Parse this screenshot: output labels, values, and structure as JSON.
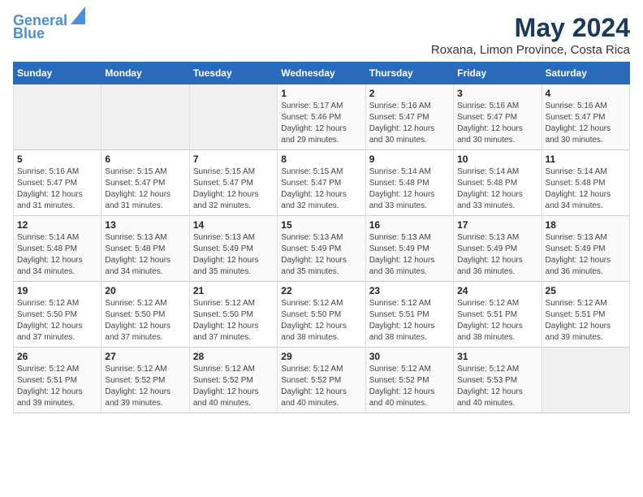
{
  "header": {
    "logo_line1": "General",
    "logo_line2": "Blue",
    "month_year": "May 2024",
    "location": "Roxana, Limon Province, Costa Rica"
  },
  "days_of_week": [
    "Sunday",
    "Monday",
    "Tuesday",
    "Wednesday",
    "Thursday",
    "Friday",
    "Saturday"
  ],
  "weeks": [
    [
      {
        "day": "",
        "info": ""
      },
      {
        "day": "",
        "info": ""
      },
      {
        "day": "",
        "info": ""
      },
      {
        "day": "1",
        "info": "Sunrise: 5:17 AM\nSunset: 5:46 PM\nDaylight: 12 hours\nand 29 minutes."
      },
      {
        "day": "2",
        "info": "Sunrise: 5:16 AM\nSunset: 5:47 PM\nDaylight: 12 hours\nand 30 minutes."
      },
      {
        "day": "3",
        "info": "Sunrise: 5:16 AM\nSunset: 5:47 PM\nDaylight: 12 hours\nand 30 minutes."
      },
      {
        "day": "4",
        "info": "Sunrise: 5:16 AM\nSunset: 5:47 PM\nDaylight: 12 hours\nand 30 minutes."
      }
    ],
    [
      {
        "day": "5",
        "info": "Sunrise: 5:16 AM\nSunset: 5:47 PM\nDaylight: 12 hours\nand 31 minutes."
      },
      {
        "day": "6",
        "info": "Sunrise: 5:15 AM\nSunset: 5:47 PM\nDaylight: 12 hours\nand 31 minutes."
      },
      {
        "day": "7",
        "info": "Sunrise: 5:15 AM\nSunset: 5:47 PM\nDaylight: 12 hours\nand 32 minutes."
      },
      {
        "day": "8",
        "info": "Sunrise: 5:15 AM\nSunset: 5:47 PM\nDaylight: 12 hours\nand 32 minutes."
      },
      {
        "day": "9",
        "info": "Sunrise: 5:14 AM\nSunset: 5:48 PM\nDaylight: 12 hours\nand 33 minutes."
      },
      {
        "day": "10",
        "info": "Sunrise: 5:14 AM\nSunset: 5:48 PM\nDaylight: 12 hours\nand 33 minutes."
      },
      {
        "day": "11",
        "info": "Sunrise: 5:14 AM\nSunset: 5:48 PM\nDaylight: 12 hours\nand 34 minutes."
      }
    ],
    [
      {
        "day": "12",
        "info": "Sunrise: 5:14 AM\nSunset: 5:48 PM\nDaylight: 12 hours\nand 34 minutes."
      },
      {
        "day": "13",
        "info": "Sunrise: 5:13 AM\nSunset: 5:48 PM\nDaylight: 12 hours\nand 34 minutes."
      },
      {
        "day": "14",
        "info": "Sunrise: 5:13 AM\nSunset: 5:49 PM\nDaylight: 12 hours\nand 35 minutes."
      },
      {
        "day": "15",
        "info": "Sunrise: 5:13 AM\nSunset: 5:49 PM\nDaylight: 12 hours\nand 35 minutes."
      },
      {
        "day": "16",
        "info": "Sunrise: 5:13 AM\nSunset: 5:49 PM\nDaylight: 12 hours\nand 36 minutes."
      },
      {
        "day": "17",
        "info": "Sunrise: 5:13 AM\nSunset: 5:49 PM\nDaylight: 12 hours\nand 36 minutes."
      },
      {
        "day": "18",
        "info": "Sunrise: 5:13 AM\nSunset: 5:49 PM\nDaylight: 12 hours\nand 36 minutes."
      }
    ],
    [
      {
        "day": "19",
        "info": "Sunrise: 5:12 AM\nSunset: 5:50 PM\nDaylight: 12 hours\nand 37 minutes."
      },
      {
        "day": "20",
        "info": "Sunrise: 5:12 AM\nSunset: 5:50 PM\nDaylight: 12 hours\nand 37 minutes."
      },
      {
        "day": "21",
        "info": "Sunrise: 5:12 AM\nSunset: 5:50 PM\nDaylight: 12 hours\nand 37 minutes."
      },
      {
        "day": "22",
        "info": "Sunrise: 5:12 AM\nSunset: 5:50 PM\nDaylight: 12 hours\nand 38 minutes."
      },
      {
        "day": "23",
        "info": "Sunrise: 5:12 AM\nSunset: 5:51 PM\nDaylight: 12 hours\nand 38 minutes."
      },
      {
        "day": "24",
        "info": "Sunrise: 5:12 AM\nSunset: 5:51 PM\nDaylight: 12 hours\nand 38 minutes."
      },
      {
        "day": "25",
        "info": "Sunrise: 5:12 AM\nSunset: 5:51 PM\nDaylight: 12 hours\nand 39 minutes."
      }
    ],
    [
      {
        "day": "26",
        "info": "Sunrise: 5:12 AM\nSunset: 5:51 PM\nDaylight: 12 hours\nand 39 minutes."
      },
      {
        "day": "27",
        "info": "Sunrise: 5:12 AM\nSunset: 5:52 PM\nDaylight: 12 hours\nand 39 minutes."
      },
      {
        "day": "28",
        "info": "Sunrise: 5:12 AM\nSunset: 5:52 PM\nDaylight: 12 hours\nand 40 minutes."
      },
      {
        "day": "29",
        "info": "Sunrise: 5:12 AM\nSunset: 5:52 PM\nDaylight: 12 hours\nand 40 minutes."
      },
      {
        "day": "30",
        "info": "Sunrise: 5:12 AM\nSunset: 5:52 PM\nDaylight: 12 hours\nand 40 minutes."
      },
      {
        "day": "31",
        "info": "Sunrise: 5:12 AM\nSunset: 5:53 PM\nDaylight: 12 hours\nand 40 minutes."
      },
      {
        "day": "",
        "info": ""
      }
    ]
  ]
}
